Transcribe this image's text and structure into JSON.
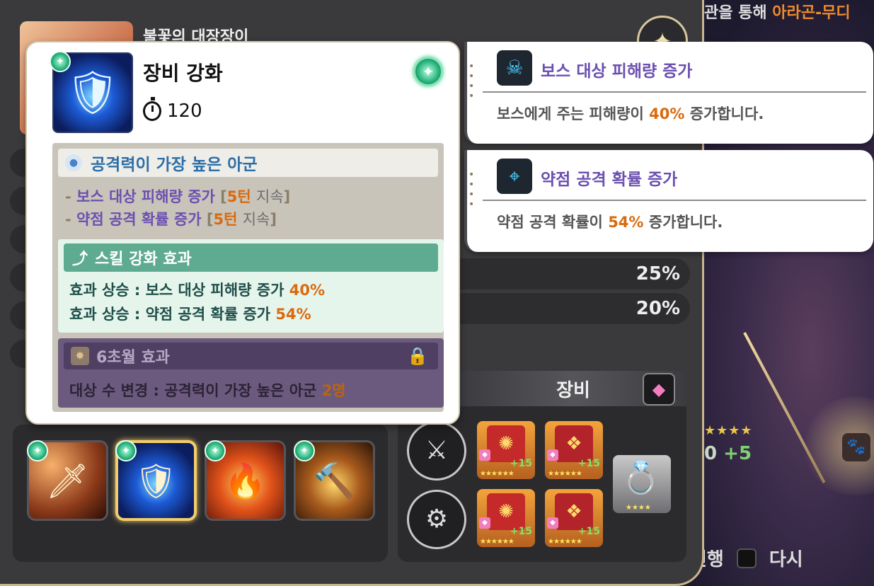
{
  "background": {
    "top_text_prefix": "관을 통해 ",
    "top_text_highlight": "아라곤-무디",
    "level_text": "0",
    "level_plus": "+5",
    "bottom_progress": "진행",
    "bottom_retry": "다시"
  },
  "hero": {
    "name": "불꽃의 대장장이"
  },
  "stats": {
    "row1_value": "25%",
    "row2_value": "20%"
  },
  "skill_detail": {
    "title": "장비 강화",
    "cooldown": "120",
    "target": "공격력이 가장 높은 아군",
    "effects": [
      {
        "name": "보스 대상 피해량 증가",
        "turns": "5턴",
        "suffix": "지속"
      },
      {
        "name": "약점 공격 확률 증가",
        "turns": "5턴",
        "suffix": "지속"
      }
    ],
    "enhance": {
      "header": "스킬 강화 효과",
      "lines": [
        {
          "label": "효과 상승 : 보스 대상 피해량 증가 ",
          "value": "40%"
        },
        {
          "label": "효과 상승 : 약점 공격 확률 증가 ",
          "value": "54%"
        }
      ]
    },
    "transcendence": {
      "header": "6초월 효과",
      "line_label": "대상 수 변경 : 공격력이 가장 높은 아군 ",
      "line_value": "2명"
    }
  },
  "buff_popovers": [
    {
      "title": "보스 대상 피해량 증가",
      "desc_prefix": "보스에게 주는 피해량이 ",
      "value": "40%",
      "desc_suffix": " 증가합니다."
    },
    {
      "title": "약점 공격 확률 증가",
      "desc_prefix": "약점 공격 확률이 ",
      "value": "54%",
      "desc_suffix": " 증가합니다."
    }
  ],
  "equipment": {
    "header": "장비",
    "items": [
      {
        "level": "+15"
      },
      {
        "level": "+15"
      },
      {
        "level": "+15"
      },
      {
        "level": "+15"
      }
    ]
  },
  "icons": {
    "gem": "sparkle-gem-icon",
    "cooldown": "stopwatch-icon",
    "lock": "lock-icon"
  },
  "colors": {
    "accent_orange": "#d96a0e",
    "effect_purple": "#6b4fb0",
    "enhance_green": "#5fab92",
    "selected_gold": "#f2cd6a"
  }
}
